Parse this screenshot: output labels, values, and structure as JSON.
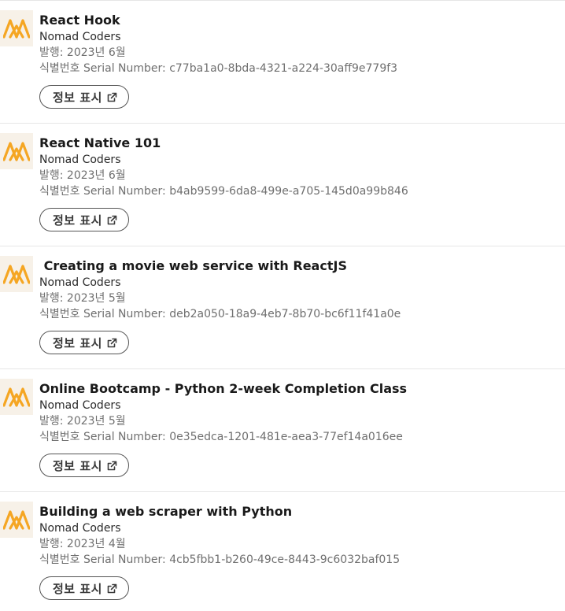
{
  "colors": {
    "logo_accent": "#f5a623",
    "logo_bg": "#f7f1e8",
    "divider": "#e6e6e6"
  },
  "icons": {
    "logo": "nomad-coders-logo-icon",
    "external": "external-link-icon"
  },
  "certificates": [
    {
      "title": "React Hook",
      "issuer": "Nomad Coders",
      "date": "발행: 2023년 6월",
      "serial": "식별번호 Serial Number: c77ba1a0-8bda-4321-a224-30aff9e779f3",
      "button": "정보 표시"
    },
    {
      "title": "React Native 101",
      "issuer": "Nomad Coders",
      "date": "발행: 2023년 6월",
      "serial": "식별번호 Serial Number: b4ab9599-6da8-499e-a705-145d0a99b846",
      "button": "정보 표시"
    },
    {
      "title": " Creating a movie web service with ReactJS",
      "issuer": "Nomad Coders",
      "date": "발행: 2023년 5월",
      "serial": "식별번호 Serial Number: deb2a050-18a9-4eb7-8b70-bc6f11f41a0e",
      "button": "정보 표시"
    },
    {
      "title": "Online Bootcamp - Python 2-week Completion Class",
      "issuer": "Nomad Coders",
      "date": "발행: 2023년 5월",
      "serial": "식별번호 Serial Number: 0e35edca-1201-481e-aea3-77ef14a016ee",
      "button": "정보 표시"
    },
    {
      "title": "Building a web scraper with Python",
      "issuer": "Nomad Coders",
      "date": "발행: 2023년 4월",
      "serial": "식별번호 Serial Number: 4cb5fbb1-b260-49ce-8443-9c6032baf015",
      "button": "정보 표시"
    }
  ]
}
